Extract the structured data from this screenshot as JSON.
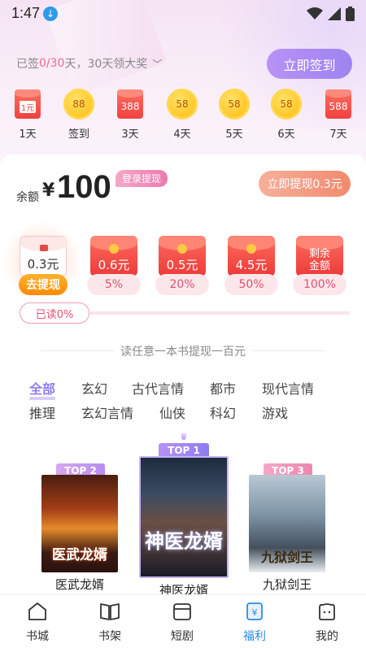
{
  "status_bar": {
    "time": "1:47"
  },
  "signin": {
    "prefix": "已签",
    "progress": "0/30",
    "suffix": "天，30天领大奖",
    "button": "立即签到"
  },
  "days": [
    {
      "reward": "1元",
      "type": "envelope",
      "label": "1天"
    },
    {
      "reward": "88",
      "type": "coin",
      "label": "签到"
    },
    {
      "reward": "388",
      "type": "envelope",
      "label": "3天"
    },
    {
      "reward": "58",
      "type": "coin",
      "label": "4天"
    },
    {
      "reward": "58",
      "type": "coin",
      "label": "5天"
    },
    {
      "reward": "58",
      "type": "coin",
      "label": "6天"
    },
    {
      "reward": "588",
      "type": "envelope",
      "label": "7天"
    }
  ],
  "balance": {
    "label": "余额",
    "currency": "¥",
    "value": "100",
    "login_badge": "登录提现",
    "withdraw_button": "立即提现0.3元"
  },
  "tiers": [
    {
      "amount": "0.3元",
      "action": "去提现"
    },
    {
      "amount": "0.6元",
      "percent": "5%"
    },
    {
      "amount": "0.5元",
      "percent": "20%"
    },
    {
      "amount": "4.5元",
      "percent": "50%"
    },
    {
      "amount": "剩余金额",
      "percent": "100%"
    }
  ],
  "read_progress": {
    "label": "已读0%",
    "fraction": 0
  },
  "divider_text": "读任意一本书提现一百元",
  "categories": [
    "全部",
    "玄幻",
    "古代言情",
    "都市",
    "现代言情",
    "推理",
    "玄幻言情",
    "仙侠",
    "科幻",
    "游戏"
  ],
  "active_category": "全部",
  "books": [
    {
      "rank": "TOP 2",
      "title": "医武龙婿",
      "cover_text": "医武龙婿"
    },
    {
      "rank": "TOP 1",
      "title": "神医龙婿",
      "cover_text": "神医龙婿"
    },
    {
      "rank": "TOP 3",
      "title": "九狱剑王",
      "cover_text": "九狱剑王"
    }
  ],
  "nav": [
    {
      "label": "书城"
    },
    {
      "label": "书架"
    },
    {
      "label": "短剧"
    },
    {
      "label": "福利"
    },
    {
      "label": "我的"
    }
  ],
  "active_nav": "福利",
  "colors": {
    "accent_purple": "#9d84f1",
    "accent_pink": "#ee6a8f",
    "nav_active": "#2a8bea",
    "envelope_red": "#ec3b3b",
    "coin_gold": "#ffc31f"
  }
}
